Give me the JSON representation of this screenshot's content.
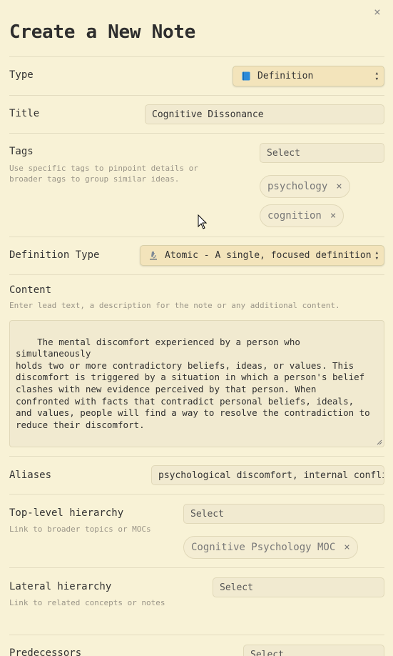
{
  "dialog": {
    "title": "Create a New Note",
    "close_icon": "×"
  },
  "type": {
    "label": "Type",
    "value": "Definition",
    "icon": "blue-book-icon"
  },
  "title_field": {
    "label": "Title",
    "value": "Cognitive Dissonance"
  },
  "tags": {
    "label": "Tags",
    "description": "Use specific tags to pinpoint details or broader tags to group similar ideas.",
    "placeholder": "Select",
    "items": [
      "psychology",
      "cognition"
    ],
    "remove_icon": "×"
  },
  "definition_type": {
    "label": "Definition Type",
    "value": "Atomic - A single, focused definition",
    "icon": "microscope-icon"
  },
  "content": {
    "label": "Content",
    "description": "Enter lead text, a description for the note or any additional content.",
    "value": "The mental discomfort experienced by a person who simultaneously\nholds two or more contradictory beliefs, ideas, or values. This\ndiscomfort is triggered by a situation in which a person's belief\nclashes with new evidence perceived by that person. When\nconfronted with facts that contradict personal beliefs, ideals,\nand values, people will find a way to resolve the contradiction to\nreduce their discomfort."
  },
  "aliases": {
    "label": "Aliases",
    "value": "psychological discomfort, internal confli"
  },
  "top_level": {
    "label": "Top-level hierarchy",
    "description": "Link to broader topics or MOCs",
    "placeholder": "Select",
    "items": [
      "Cognitive Psychology MOC"
    ]
  },
  "lateral": {
    "label": "Lateral hierarchy",
    "description": "Link to related concepts or notes",
    "placeholder": "Select"
  },
  "predecessors": {
    "label": "Predecessors",
    "placeholder": "Select"
  },
  "colors": {
    "background": "#f8f2d6",
    "field": "#f1ead0",
    "dropdown": "#f3e4bb",
    "book_icon": "#2b8ad8"
  }
}
